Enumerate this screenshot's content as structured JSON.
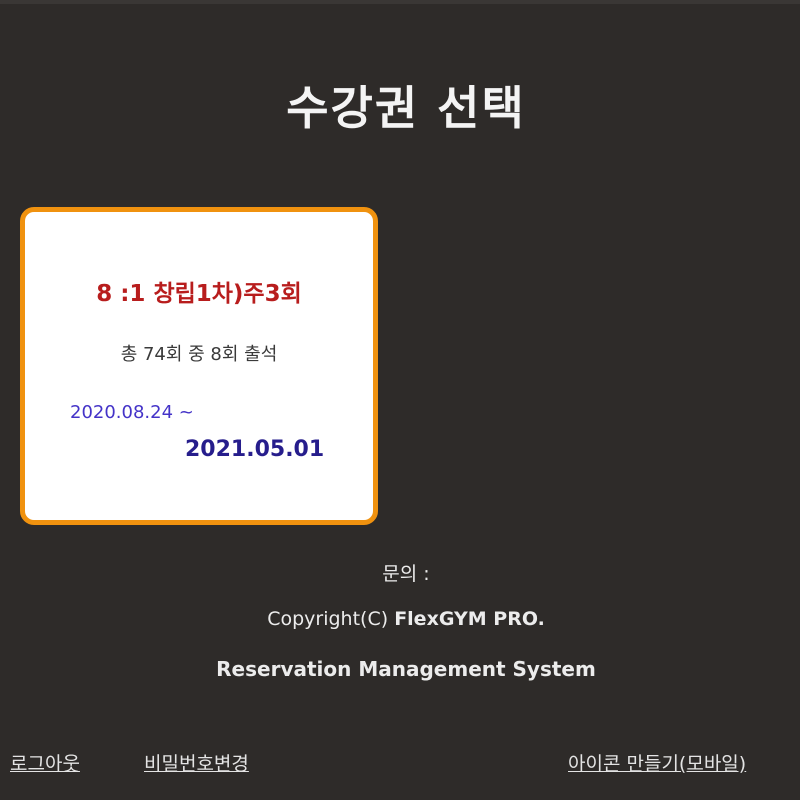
{
  "page": {
    "title": "수강권 선택"
  },
  "pass_card": {
    "name": "8 :1 창립1차)주3회",
    "attendance": "총 74회 중 8회 출석",
    "start_date": "2020.08.24 ~",
    "end_date": "2021.05.01"
  },
  "footer": {
    "contact_label": "문의 :",
    "copyright_prefix": "Copyright(C) ",
    "copyright_brand": "FlexGYM PRO.",
    "system_name": "Reservation Management System"
  },
  "links": {
    "logout": "로그아웃",
    "change_password": "비밀번호변경",
    "make_icon": "아이콘 만들기(모바일)"
  },
  "colors": {
    "background": "#2e2b29",
    "card_border": "#f0920f",
    "pass_name": "#b81d1d",
    "start_date": "#4433c8",
    "end_date": "#261d8c"
  }
}
